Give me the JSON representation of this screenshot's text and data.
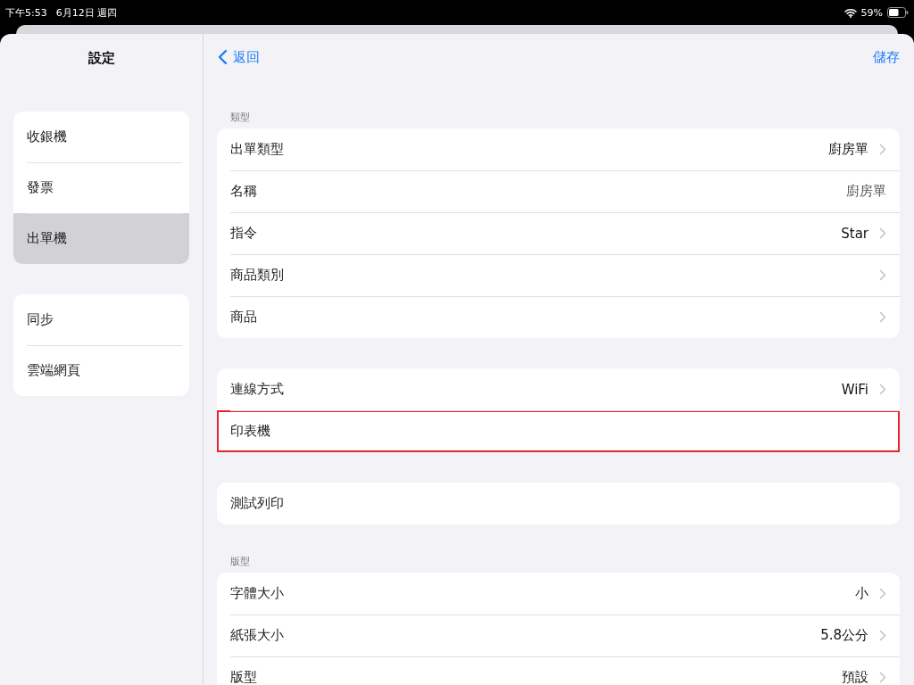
{
  "status_bar": {
    "time": "下午5:53",
    "date": "6月12日 週四",
    "battery": "59%"
  },
  "sidebar": {
    "title": "設定",
    "groups": [
      [
        {
          "label": "收銀機",
          "selected": false
        },
        {
          "label": "發票",
          "selected": false
        },
        {
          "label": "出單機",
          "selected": true
        }
      ],
      [
        {
          "label": "同步",
          "selected": false
        },
        {
          "label": "雲端網頁",
          "selected": false
        }
      ]
    ]
  },
  "nav": {
    "back": "返回",
    "save": "儲存"
  },
  "sections": [
    {
      "header": "類型",
      "rows": [
        {
          "kind": "nav",
          "label": "出單類型",
          "value": "廚房單",
          "highlighted": false
        },
        {
          "kind": "field",
          "label": "名稱",
          "value": "廚房單",
          "highlighted": false
        },
        {
          "kind": "nav",
          "label": "指令",
          "value": "Star",
          "highlighted": false
        },
        {
          "kind": "nav",
          "label": "商品類別",
          "highlighted": false
        },
        {
          "kind": "nav",
          "label": "商品",
          "highlighted": false
        }
      ]
    },
    {
      "rows": [
        {
          "kind": "nav",
          "label": "連線方式",
          "value": "WiFi",
          "highlighted": false
        },
        {
          "kind": "plain",
          "label": "印表機",
          "highlighted": true
        }
      ]
    },
    {
      "rows": [
        {
          "kind": "plain",
          "label": "測試列印",
          "highlighted": false
        }
      ]
    },
    {
      "header": "版型",
      "rows": [
        {
          "kind": "nav",
          "label": "字體大小",
          "value": "小",
          "highlighted": false
        },
        {
          "kind": "nav",
          "label": "紙張大小",
          "value": "5.8公分",
          "highlighted": false
        },
        {
          "kind": "nav",
          "label": "版型",
          "value": "預設",
          "highlighted": false
        }
      ]
    }
  ]
}
